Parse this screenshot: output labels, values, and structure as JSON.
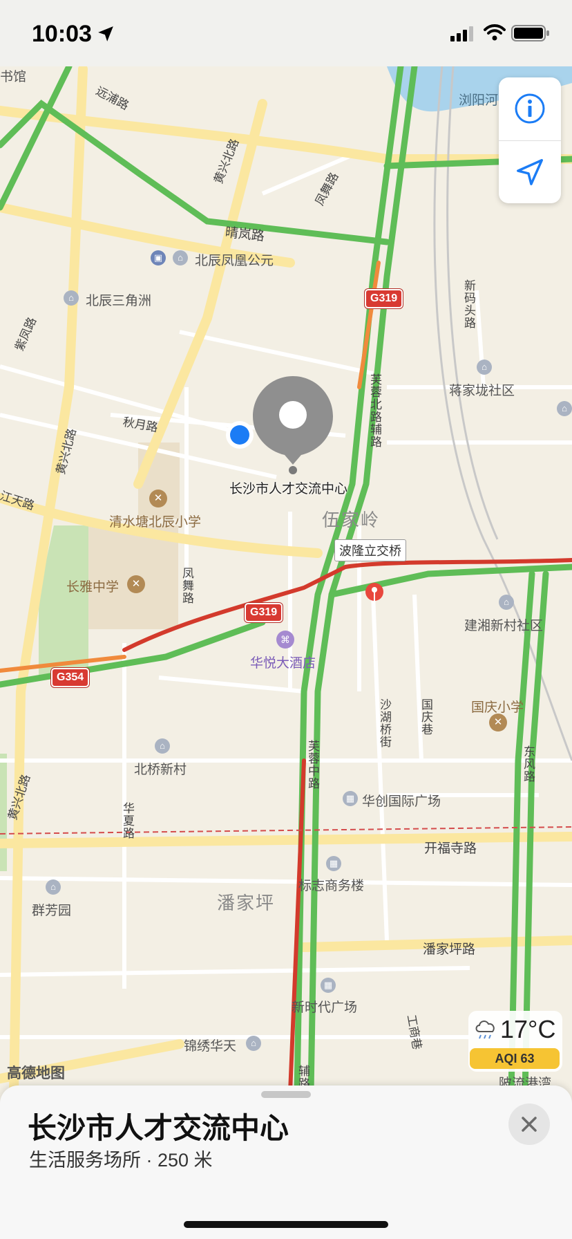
{
  "status_bar": {
    "time": "10:03"
  },
  "map": {
    "labels": {
      "shuguan": "书馆",
      "yuanpu_rd": "远浦路",
      "liuyang_river": "浏阳河",
      "huangxing_n_rd_top": "黄兴北路",
      "fengwu_rd_top": "凤舞路",
      "qinglan_rd": "晴岚路",
      "beichen_fenghuang": "北辰凤凰公元",
      "beichen_sanjiaozhou": "北辰三角洲",
      "zifeng_rd": "紫凤路",
      "xinma_rd": "新码头路",
      "jiangjialong": "蒋家垅社区",
      "qiuyue_rd": "秋月路",
      "furong_n_rd_fudao": "芙蓉北路辅路",
      "huangxing_n_rd_mid": "黄兴北路",
      "jiangtian_rd": "江天路",
      "qingshuitang_school": "清水塘北辰小学",
      "wujialing": "伍家岭",
      "bolong_bridge": "波隆立交桥",
      "changya_school": "长雅中学",
      "fengwu_rd_mid": "凤舞路",
      "huayue_hotel": "华悦大酒店",
      "jianxiang": "建湘新村社区",
      "guoqing_school": "国庆小学",
      "shahu_bridge_st": "沙湖桥街",
      "guoqing_lane": "国庆巷",
      "beiqiao": "北桥新村",
      "furong_mid_rd": "芙蓉中路",
      "dongfeng_rd": "东风路",
      "huachuang": "华创国际广场",
      "huangxing_n_rd_low": "黄兴北路",
      "huatou_rd": "华夏路",
      "kaifusi_rd": "开福寺路",
      "biaozhi": "标志商务楼",
      "panjiaping": "潘家坪",
      "qunfangyuan": "群芳园",
      "panjiaping_rd": "潘家坪路",
      "xinshidai": "新时代广场",
      "jinxiu": "锦绣华天",
      "gongshang_lane": "工商巷",
      "ningbo_lane": "陂流港湾",
      "pu_rd": "辅路"
    },
    "shields": {
      "g319_top": "G319",
      "g319_mid": "G319",
      "g354": "G354"
    },
    "selected_place_label": "长沙市人才交流中心",
    "logo": "高德地图"
  },
  "controls": {
    "info_icon": "info-icon",
    "location_icon": "location-arrow-icon"
  },
  "weather": {
    "temp": "17°C",
    "aqi": "AQI 63"
  },
  "card": {
    "title": "长沙市人才交流中心",
    "subtitle": "生活服务场所 · 250 米"
  }
}
